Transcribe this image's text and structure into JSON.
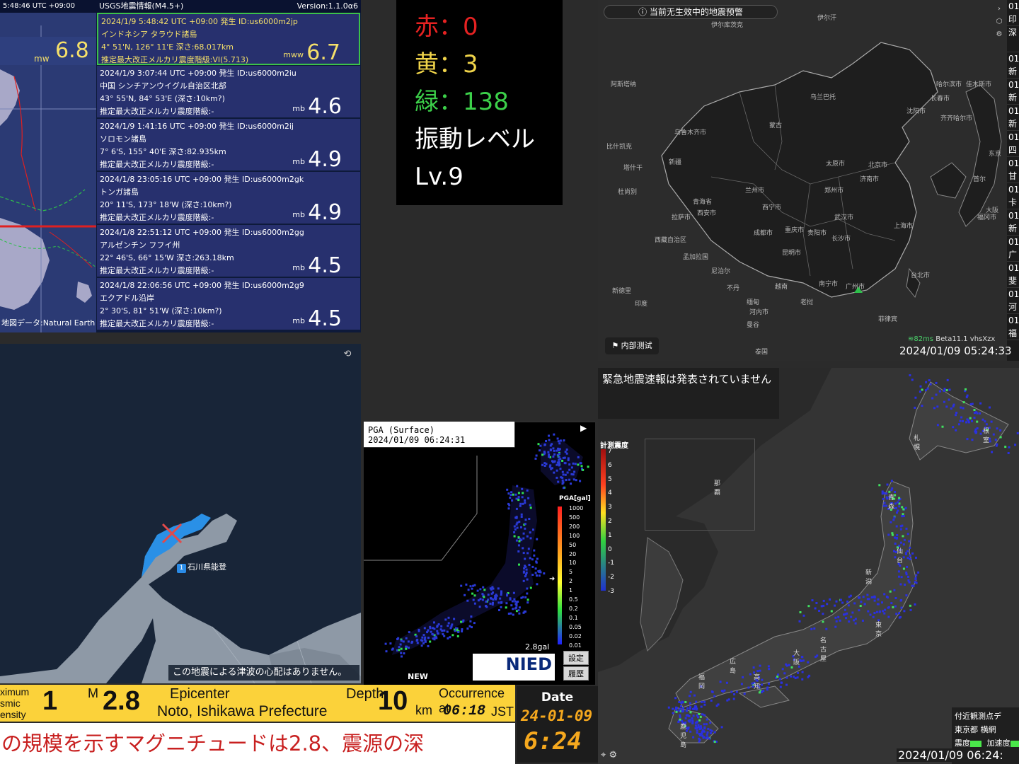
{
  "usgs": {
    "top_left_time": "5:48:46  UTC +09:00",
    "title": "USGS地震情報(M4.5+)",
    "version": "Version:1.1.0α6",
    "left_mag_unit": "mw",
    "left_mag_value": "6.8",
    "map_source": "地図データ:Natural Earth",
    "quakes": [
      {
        "l1": "2024/1/9 5:48:42   UTC +09:00 発生  ID:us6000m2jp",
        "l2": "インドネシア タラウド諸島",
        "l3": "4° 51'N, 126° 11'E   深さ:68.017km",
        "l4": "推定最大改正メルカリ震度階級:VI(5.713)",
        "unit": "mww",
        "mag": "6.7"
      },
      {
        "l1": "2024/1/9 3:07:44   UTC +09:00 発生  ID:us6000m2iu",
        "l2": "中国 シンチアンウイグル自治区北部",
        "l3": "43° 55'N, 84° 53'E   (深さ:10km?)",
        "l4": "推定最大改正メルカリ震度階級:-",
        "unit": "mb",
        "mag": "4.6"
      },
      {
        "l1": "2024/1/9 1:41:16   UTC +09:00 発生  ID:us6000m2ij",
        "l2": "ソロモン諸島",
        "l3": "7° 6'S, 155° 40'E   深さ:82.935km",
        "l4": "推定最大改正メルカリ震度階級:-",
        "unit": "mb",
        "mag": "4.9"
      },
      {
        "l1": "2024/1/8 23:05:16   UTC +09:00 発生  ID:us6000m2gk",
        "l2": "トンガ諸島",
        "l3": "20° 11'S, 173° 18'W   (深さ:10km?)",
        "l4": "推定最大改正メルカリ震度階級:-",
        "unit": "mb",
        "mag": "4.9"
      },
      {
        "l1": "2024/1/8 22:51:12   UTC +09:00 発生  ID:us6000m2gg",
        "l2": "アルゼンチン  フフイ州",
        "l3": "22° 46'S, 66° 15'W   深さ:263.18km",
        "l4": "推定最大改正メルカリ震度階級:-",
        "unit": "mb",
        "mag": "4.5"
      },
      {
        "l1": "2024/1/8 22:06:56   UTC +09:00 発生  ID:us6000m2g9",
        "l2": "エクアドル沿岸",
        "l3": "2° 30'S, 81° 51'W   (深さ:10km?)",
        "l4": "推定最大改正メルカリ震度階級:-",
        "unit": "mb",
        "mag": "4.5"
      }
    ]
  },
  "level": {
    "red": "赤：0",
    "yellow": "黄：3",
    "green": "緑：138",
    "label": "振動レベル",
    "value": "Lv.9"
  },
  "china": {
    "warning": "当前无生效中的地震预警",
    "test_button": "内部测试",
    "ping": "82ms",
    "version": "Beta11.1 vhsXzx",
    "time": "2024/01/09 05:24:33",
    "sidebar": [
      "01 印",
      "深",
      "01 新",
      "01 新",
      "01 新",
      "01 四",
      "01 甘",
      "01 卡",
      "01 新",
      "01 广",
      "01 斐",
      "01 河",
      "01 福"
    ],
    "place_labels": [
      "乌鲁木齐市",
      "西宁市",
      "成都市",
      "拉萨市",
      "西安市",
      "北京市",
      "沈阳市",
      "长春市",
      "哈尔滨市",
      "兰州市",
      "贵阳市",
      "昆明市",
      "南宁市",
      "广州市",
      "台北市",
      "上海市",
      "武汉市",
      "长沙市",
      "重庆市",
      "郑州市",
      "济南市",
      "太原市",
      "乌兰巴托",
      "首尔",
      "东京",
      "大阪",
      "福冈市",
      "印度",
      "缅甸",
      "泰国",
      "越南",
      "河内市",
      "老挝",
      "菲律宾",
      "曼谷",
      "孟加拉国",
      "尼泊尔",
      "不丹",
      "新德里",
      "伊尔库茨克",
      "比什凯克",
      "阿斯塔纳",
      "佳木斯市",
      "齐齐哈尔市",
      "蒙古",
      "塔什干",
      "杜尚别",
      "伊尔汗",
      "西藏自治区",
      "青海省",
      "新疆"
    ]
  },
  "tsunami": {
    "label_num": "1",
    "label_text": "石川県能登",
    "note": "この地震による津波の心配はありません。"
  },
  "pga": {
    "title_l1": "PGA (Surface)",
    "title_l2": "2024/01/09 06:24:31",
    "unit": "PGA[gal]",
    "scale": [
      "1000",
      "500",
      "200",
      "100",
      "50",
      "20",
      "10",
      "5",
      "2",
      "1",
      "0.5",
      "0.2",
      "0.1",
      "0.05",
      "0.02",
      "0.01"
    ],
    "gal": "2.8gal",
    "new": "NEW",
    "logo": "NIED",
    "btn_settings": "設定",
    "btn_history": "履歴"
  },
  "jmap": {
    "title": "緊急地震速報は発表されていません",
    "scale_title": "計測震度",
    "scale": [
      "7",
      "6",
      "5",
      "4",
      "3",
      "2",
      "1",
      "0",
      "-1",
      "-2",
      "-3"
    ],
    "legend_l1": "付近観測点デ",
    "legend_l2": "東京都 横網",
    "legend_l3": "震度",
    "legend_l4": "加速度",
    "time": "2024/01/09 06:24:",
    "cities": [
      "札幌",
      "青森",
      "新潟",
      "仙台",
      "名古屋",
      "大阪",
      "広島",
      "高知",
      "福岡",
      "鹿児島",
      "那覇",
      "根室",
      "東京"
    ]
  },
  "bar": {
    "intensity_label": "ximum\nsmic\nensity",
    "intensity": "1",
    "m_label": "M",
    "magnitude": "2.8",
    "epicenter_label": "Epicenter",
    "epicenter": "Noto, Ishikawa Prefecture",
    "depth_label": "Depth",
    "depth": "10",
    "depth_unit": "km",
    "occurrence_label": "Occurrence at",
    "occurrence": "06:18",
    "tz": "JST",
    "date_label": "Date",
    "date": "24-01-09",
    "time": "6:24",
    "ticker": "の規模を示すマグニチュードは2.8、震源の深"
  },
  "colors": {
    "usgs_bg": "#27306e",
    "accent_yellow": "#f5e06a",
    "accent_green": "#3cc24a",
    "bar_yellow": "#fbd23a",
    "ticker_red": "#c82020"
  }
}
